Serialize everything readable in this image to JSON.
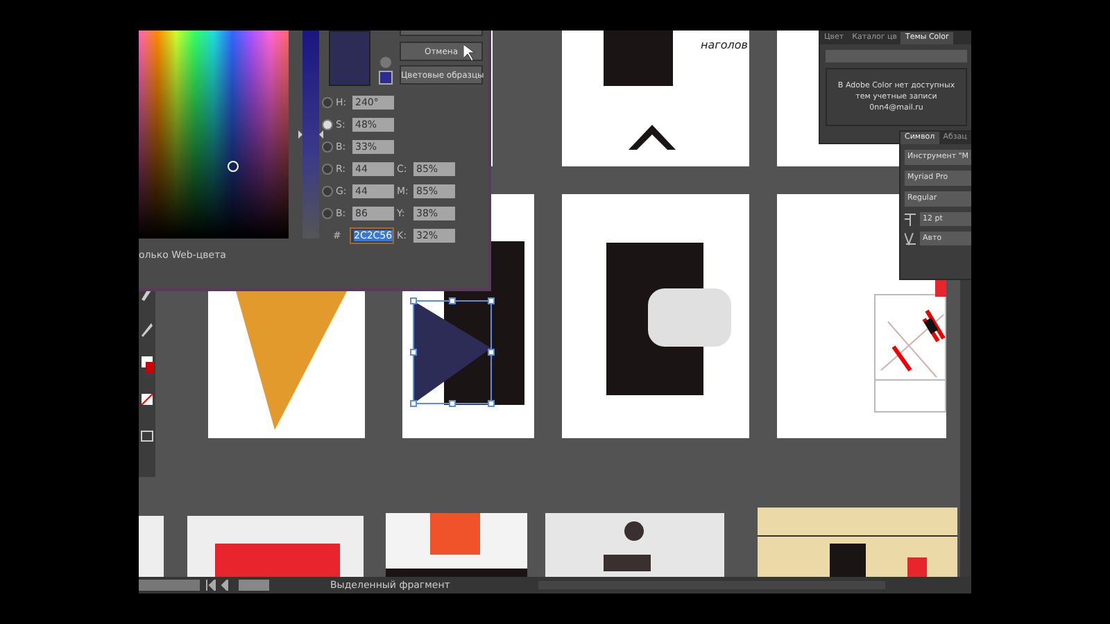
{
  "artboard_text": "наголов",
  "color_picker": {
    "buttons": [
      "Отмена",
      "Цветовые образцы"
    ],
    "hue_slider": {
      "level": 0.5
    },
    "fields": [
      {
        "label": "H:",
        "value": "240°",
        "selected": false
      },
      {
        "label": "S:",
        "value": "48%",
        "selected": true
      },
      {
        "label": "B:",
        "value": "33%",
        "selected": false
      },
      {
        "label": "R:",
        "value": "44",
        "selected": false
      },
      {
        "label": "G:",
        "value": "44",
        "selected": false
      },
      {
        "label": "B:",
        "value": "86",
        "selected": false
      }
    ],
    "hex": {
      "label": "#",
      "value": "2C2C56"
    },
    "cmyk": [
      {
        "label": "C:",
        "value": "85%"
      },
      {
        "label": "M:",
        "value": "85%"
      },
      {
        "label": "Y:",
        "value": "38%"
      },
      {
        "label": "K:",
        "value": "32%"
      }
    ],
    "web_only_label": "олько Web-цвета"
  },
  "color_panel": {
    "tabs": [
      {
        "label": "Цвет",
        "selected": false
      },
      {
        "label": "Каталог цв",
        "selected": false
      },
      {
        "label": "Темы Color",
        "selected": true
      }
    ],
    "message": "В Adobe Color нет доступных тем учетные записи 0nn4@mail.ru"
  },
  "character_panel": {
    "tabs": [
      {
        "label": "Символ",
        "selected": true
      },
      {
        "label": "Абзац",
        "selected": false
      }
    ],
    "tool_label": "Инструмент \"М",
    "font": "Myriad Pro",
    "style": "Regular",
    "size": "12 pt",
    "tracking": "Авто"
  },
  "status_bar": {
    "label": "Выделенный фрагмент"
  }
}
